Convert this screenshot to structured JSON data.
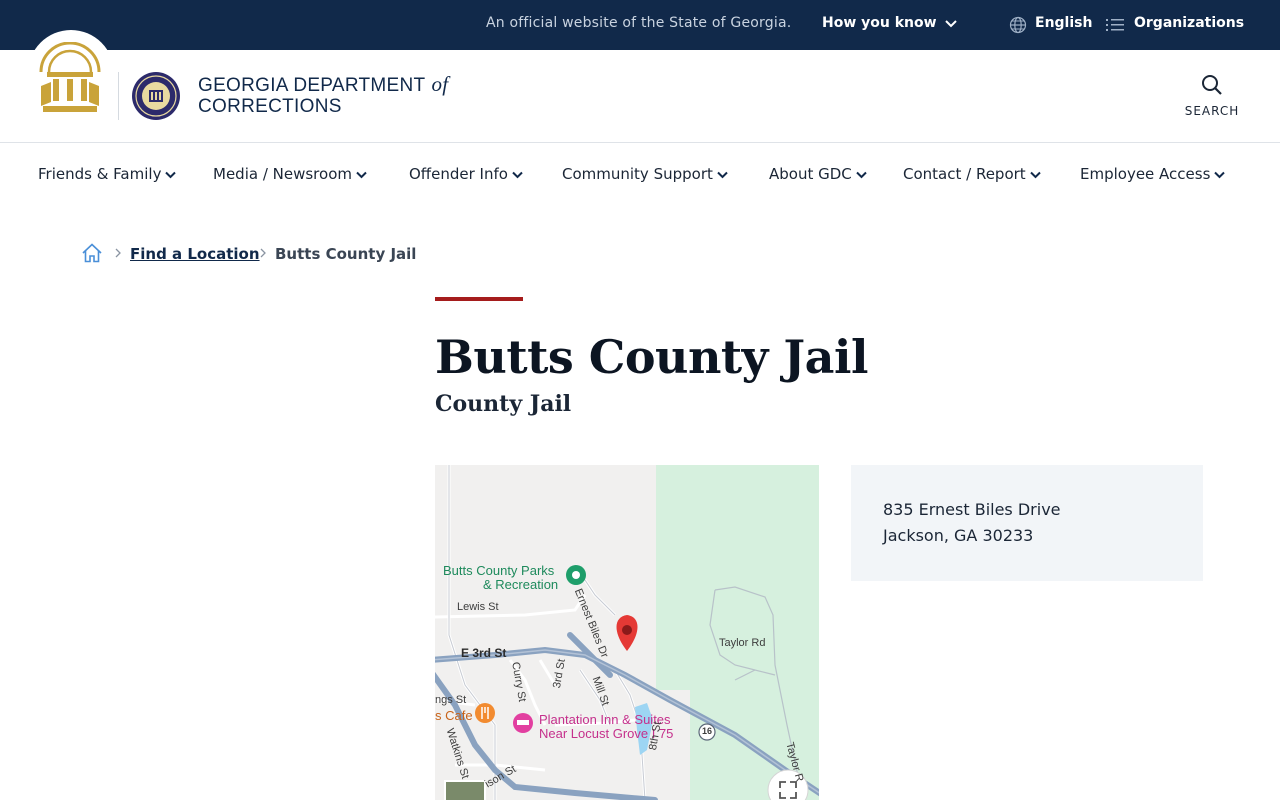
{
  "topbar": {
    "official_text": "An official website of the State of Georgia.",
    "how_you_know": "How you know",
    "language": "English",
    "organizations": "Organizations"
  },
  "header": {
    "brand_line1": "GEORGIA DEPARTMENT",
    "brand_of": "of",
    "brand_line2": "CORRECTIONS",
    "search_label": "SEARCH"
  },
  "nav": {
    "items": [
      {
        "label": "Friends & Family"
      },
      {
        "label": "Media / Newsroom"
      },
      {
        "label": "Offender Info"
      },
      {
        "label": "Community Support"
      },
      {
        "label": "About GDC"
      },
      {
        "label": "Contact / Report"
      },
      {
        "label": "Employee Access"
      }
    ]
  },
  "breadcrumb": {
    "link": "Find a Location",
    "current": "Butts County Jail"
  },
  "page": {
    "title": "Butts County Jail",
    "subtitle": "County Jail"
  },
  "map": {
    "labels": {
      "parks1": "Butts County Parks",
      "parks2": "& Recreation",
      "lewis": "Lewis St",
      "ernest": "Ernest Biles Dr",
      "taylor": "Taylor Rd",
      "taylor2": "Taylor R",
      "e3rd": "E 3rd St",
      "curry": "Curry St",
      "third": "3rd St",
      "mill": "Mill St",
      "ngs": "ngs St",
      "cafe": "s Cafe",
      "hotel1": "Plantation Inn & Suites",
      "hotel2": "Near Locust Grove I 75",
      "watkins": "Watkins St",
      "ison": "ison St",
      "eighth": "8th St",
      "route": "16"
    }
  },
  "address": {
    "line1": "835 Ernest Biles Drive",
    "line2": "Jackson, GA 30233"
  },
  "colors": {
    "topbar_bg": "#11294a",
    "accent_red": "#a51c1c",
    "gold": "#c9a33a",
    "address_bg": "#f2f5f8"
  }
}
